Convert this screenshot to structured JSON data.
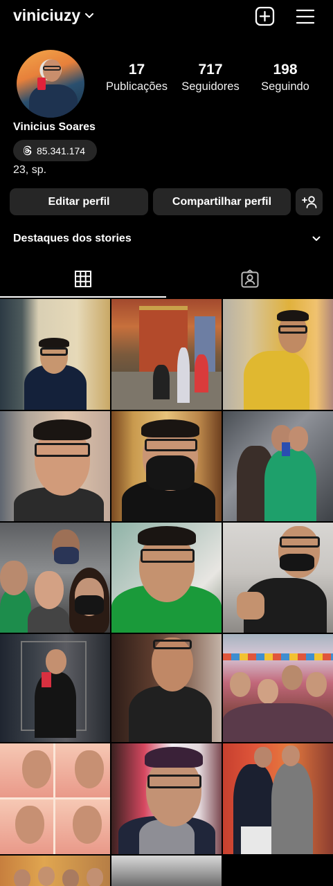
{
  "header": {
    "username": "viniciuzy"
  },
  "profile": {
    "full_name": "Vinicius Soares",
    "threads_count": "85.341.174",
    "bio": "23, sp."
  },
  "stats": [
    {
      "value": "17",
      "label": "Publicações"
    },
    {
      "value": "717",
      "label": "Seguidores"
    },
    {
      "value": "198",
      "label": "Seguindo"
    }
  ],
  "buttons": {
    "edit": "Editar perfil",
    "share": "Compartilhar perfil"
  },
  "highlights": {
    "title": "Destaques dos stories"
  },
  "tabs": [
    {
      "icon": "grid-icon",
      "active": true
    },
    {
      "icon": "tagged-person-icon",
      "active": false
    }
  ],
  "colors": {
    "background": "#000000",
    "button": "#262626",
    "text": "#ffffff"
  },
  "posts": [
    {
      "icon": "photo-selfie-peace"
    },
    {
      "icon": "photo-castle-group"
    },
    {
      "icon": "photo-selfie-yellow-shirt"
    },
    {
      "icon": "photo-selfie-glasses-closeup"
    },
    {
      "icon": "photo-selfie-black-mask"
    },
    {
      "icon": "photo-mirror-selfie-group"
    },
    {
      "icon": "photo-group-masks"
    },
    {
      "icon": "photo-selfie-green-shirt"
    },
    {
      "icon": "photo-selfie-peace-gym"
    },
    {
      "icon": "photo-mirror-selfie-red-phone"
    },
    {
      "icon": "photo-selfie-black-shirt"
    },
    {
      "icon": "photo-party-group"
    },
    {
      "icon": "photo-collage-four"
    },
    {
      "icon": "photo-selfie-hoodie"
    },
    {
      "icon": "photo-two-friends-event"
    },
    {
      "icon": "photo-group-partial"
    },
    {
      "icon": "photo-elevator-partial"
    }
  ]
}
